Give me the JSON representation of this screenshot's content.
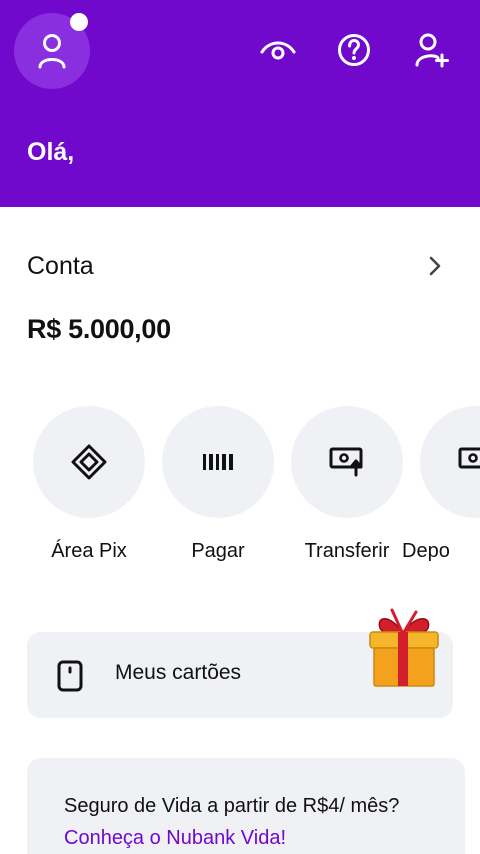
{
  "header": {
    "greeting": "Olá,",
    "background": "#7109cc",
    "icons": [
      "user-icon",
      "eye-icon",
      "help-icon",
      "invite-user-icon"
    ]
  },
  "account": {
    "title": "Conta",
    "balance": "R$ 5.000,00"
  },
  "actions": [
    {
      "label": "Área Pix",
      "icon": "pix-icon"
    },
    {
      "label": "Pagar",
      "icon": "barcode-icon"
    },
    {
      "label": "Transferir",
      "icon": "transfer-icon"
    },
    {
      "label": "Depo",
      "icon": "deposit-icon"
    }
  ],
  "cards": {
    "label": "Meus cartões",
    "icon": "card-icon",
    "badge_icon": "gift-icon"
  },
  "promo": {
    "text": "Seguro de Vida a partir de R$4/ mês? ",
    "link": "Conheça o Nubank Vida!",
    "link_color": "#7109cc"
  }
}
